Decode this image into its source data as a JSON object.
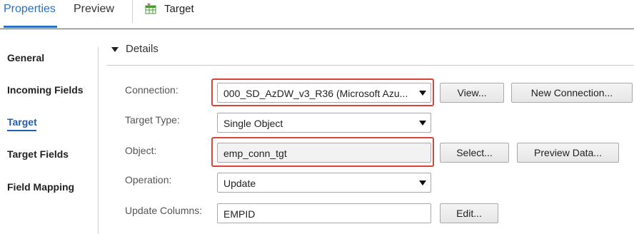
{
  "tabs": [
    {
      "label": "Properties",
      "active": true
    },
    {
      "label": "Preview",
      "active": false
    }
  ],
  "object_title": "Target",
  "icons": {
    "target": "table-icon"
  },
  "nav": [
    {
      "label": "General"
    },
    {
      "label": "Incoming Fields"
    },
    {
      "label": "Target",
      "active": true
    },
    {
      "label": "Target Fields"
    },
    {
      "label": "Field Mapping"
    }
  ],
  "section": {
    "title": "Details",
    "expanded": true
  },
  "form": {
    "connection": {
      "label": "Connection:",
      "value": "000_SD_AzDW_v3_R36 (Microsoft Azu...",
      "view_button": "View...",
      "new_button": "New Connection..."
    },
    "target_type": {
      "label": "Target Type:",
      "value": "Single Object"
    },
    "object": {
      "label": "Object:",
      "value": "emp_conn_tgt",
      "select_button": "Select...",
      "preview_button": "Preview Data..."
    },
    "operation": {
      "label": "Operation:",
      "value": "Update"
    },
    "update_columns": {
      "label": "Update Columns:",
      "value": "EMPID",
      "edit_button": "Edit..."
    }
  },
  "colors": {
    "accent": "#2a6fc9",
    "highlight": "#d9433a"
  }
}
